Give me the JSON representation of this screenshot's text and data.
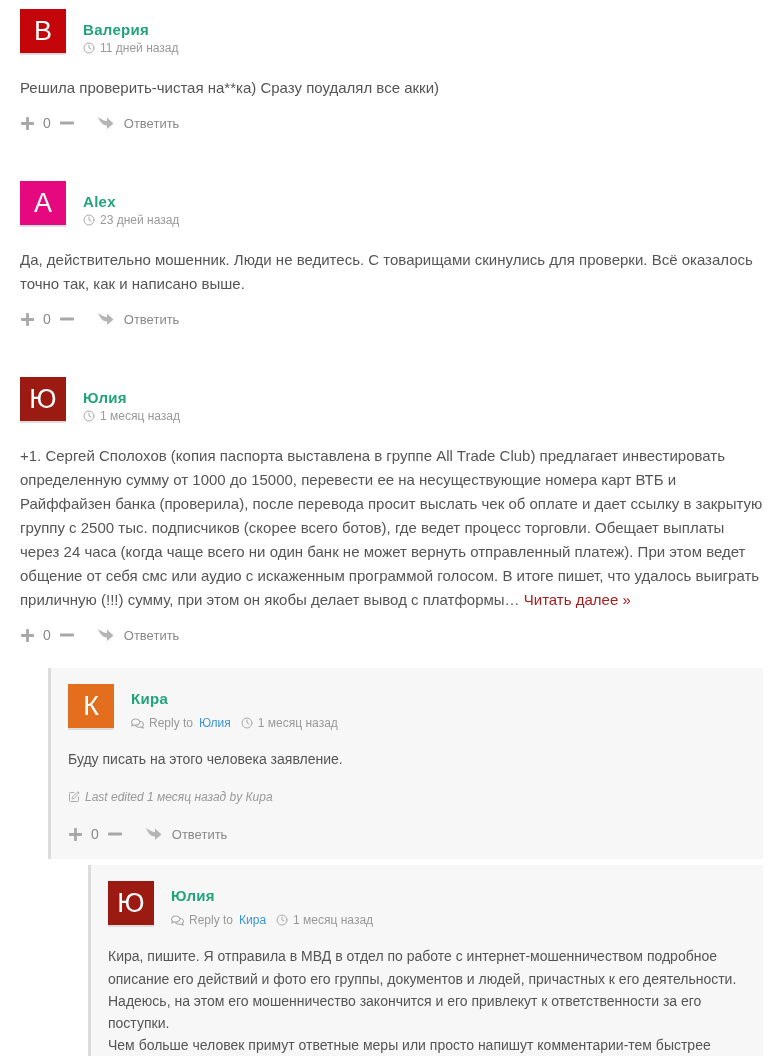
{
  "comments": [
    {
      "author": "Валерия",
      "avatar_letter": "В",
      "color": "#c4060a",
      "time": "11 дней назад",
      "text": [
        "Решила проверить-чистая на**ка) Сразу поудалял все акки)"
      ],
      "votes": "0",
      "reply_label": "Ответить"
    },
    {
      "author": "Alex",
      "avatar_letter": "A",
      "color": "#e5087e",
      "time": "23 дней назад",
      "text": [
        "Да, действительно мошенник. Люди не ведитесь. С товарищами скинулись для проверки. Всё оказалось точно так, как и написано выше."
      ],
      "votes": "0",
      "reply_label": "Ответить"
    },
    {
      "author": "Юлия",
      "avatar_letter": "Ю",
      "color": "#9b1b12",
      "time": "1 месяц назад",
      "text": [
        "+1. Сергей Сполохов (копия паспорта выставлена в группе All Trade Club) предлагает инвестировать определенную сумму от 1000 до 15000, перевести ее на несуществующие номера карт ВТБ и Райффайзен банка (проверила), после перевода просит выслать чек об оплате и дает ссылку в закрытую группу с 2500 тыс. подписчиков (скорее всего ботов), где ведет процесс торговли. Обещает выплаты через 24 часа (когда чаще всего ни один банк не может вернуть отправленный платеж). При этом ведет общение от себя смс или аудио с искаженным программой голосом. В итоге пишет, что удалось выиграть приличную (!!!) сумму, при этом он якобы делает вывод с платформы…"
      ],
      "read_more": "Читать далее »",
      "votes": "0",
      "reply_label": "Ответить",
      "children": [
        {
          "author": "Кира",
          "avatar_letter": "К",
          "color": "#e36f1e",
          "reply_to_label": "Reply to",
          "reply_to": "Юлия",
          "time": "1 месяц назад",
          "text": [
            "Буду писать на этого человека заявление."
          ],
          "edited": "Last edited 1 месяц назад by Кира",
          "votes": "0",
          "reply_label": "Ответить",
          "children": [
            {
              "author": "Юлия",
              "avatar_letter": "Ю",
              "color": "#9b1b12",
              "reply_to_label": "Reply to",
              "reply_to": "Кира",
              "time": "1 месяц назад",
              "text": [
                "Кира, пишите. Я отправила в МВД в отдел по работе с интернет-мошенничеством подробное описание его действий и фото его группы, документов и людей, причастных к его деятельности. Надеюсь, на этом его мошенничество закончится и его привлекут к ответственности за его поступки.",
                "Чем больше человек примут ответные меры или просто напишут комментарии-тем быстрее"
              ]
            }
          ]
        }
      ]
    }
  ]
}
